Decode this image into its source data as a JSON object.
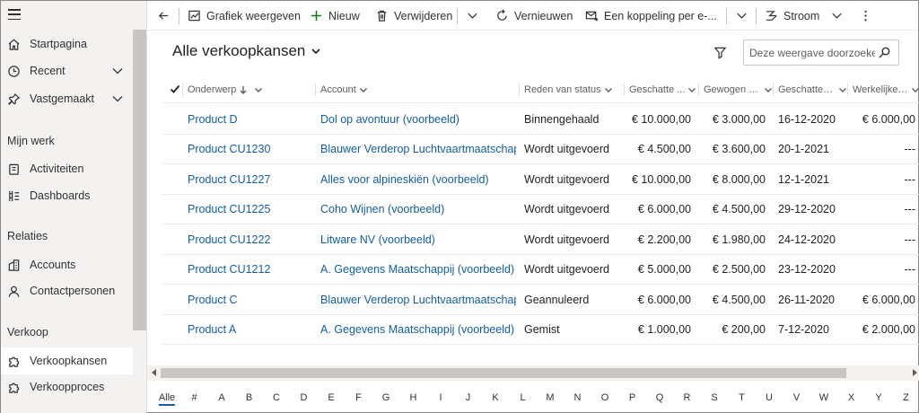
{
  "sidebar": {
    "items": [
      {
        "label": "Startpagina",
        "icon": "home-icon"
      },
      {
        "label": "Recent",
        "icon": "clock-icon"
      },
      {
        "label": "Vastgemaakt",
        "icon": "pin-icon"
      }
    ],
    "groups": [
      {
        "title": "Mijn werk",
        "items": [
          {
            "label": "Activiteiten",
            "icon": "activities-icon"
          },
          {
            "label": "Dashboards",
            "icon": "dashboard-icon"
          }
        ]
      },
      {
        "title": "Relaties",
        "items": [
          {
            "label": "Accounts",
            "icon": "account-icon"
          },
          {
            "label": "Contactpersonen",
            "icon": "person-icon"
          }
        ]
      },
      {
        "title": "Verkoop",
        "items": [
          {
            "label": "Verkoopkansen",
            "icon": "puzzle-icon",
            "active": true
          },
          {
            "label": "Verkoopproces",
            "icon": "puzzle-icon"
          }
        ]
      }
    ]
  },
  "command_bar": {
    "chart": "Grafiek weergeven",
    "new": "Nieuw",
    "delete": "Verwijderen",
    "refresh": "Vernieuwen",
    "email_link": "Een koppeling per e-...",
    "flow": "Stroom"
  },
  "view": {
    "title": "Alle verkoopkansen",
    "search_placeholder": "Deze weergave doorzoeke"
  },
  "grid": {
    "columns": [
      "Onderwerp",
      "Account",
      "Reden van status",
      "Geschatte ...",
      "Gewogen o...",
      "Geschatte s...",
      "Werkelijke ..."
    ],
    "rows": [
      {
        "subject": "Product D",
        "account": "Dol op avontuur (voorbeeld)",
        "status": "Binnengehaald",
        "est_revenue": "€ 10.000,00",
        "weighted": "€ 3.000,00",
        "est_close": "16-12-2020",
        "actual": "€ 6.000,00"
      },
      {
        "subject": "Product CU1230",
        "account": "Blauwer Verderop Luchtvaartmaatschappij",
        "status": "Wordt uitgevoerd",
        "est_revenue": "€ 4.500,00",
        "weighted": "€ 3.600,00",
        "est_close": "20-1-2021",
        "actual": "---"
      },
      {
        "subject": "Product CU1227",
        "account": "Alles voor alpineskiën (voorbeeld)",
        "status": "Wordt uitgevoerd",
        "est_revenue": "€ 10.000,00",
        "weighted": "€ 8.000,00",
        "est_close": "12-1-2021",
        "actual": "---"
      },
      {
        "subject": "Product CU1225",
        "account": "Coho Wijnen (voorbeeld)",
        "status": "Wordt uitgevoerd",
        "est_revenue": "€ 6.000,00",
        "weighted": "€ 4.500,00",
        "est_close": "29-12-2020",
        "actual": "---"
      },
      {
        "subject": "Product CU1222",
        "account": "Litware NV (voorbeeld)",
        "status": "Wordt uitgevoerd",
        "est_revenue": "€ 2.200,00",
        "weighted": "€ 1.980,00",
        "est_close": "24-12-2020",
        "actual": "---"
      },
      {
        "subject": "Product CU1212",
        "account": "A. Gegevens Maatschappij (voorbeeld)",
        "status": "Wordt uitgevoerd",
        "est_revenue": "€ 5.000,00",
        "weighted": "€ 2.500,00",
        "est_close": "23-12-2020",
        "actual": "---"
      },
      {
        "subject": "Product C",
        "account": "Blauwer Verderop Luchtvaartmaatschappij",
        "status": "Geannuleerd",
        "est_revenue": "€ 6.000,00",
        "weighted": "€ 4.500,00",
        "est_close": "26-11-2020",
        "actual": "€ 6.000,00"
      },
      {
        "subject": "Product A",
        "account": "A. Gegevens Maatschappij (voorbeeld)",
        "status": "Gemist",
        "est_revenue": "€ 1.000,00",
        "weighted": "€ 200,00",
        "est_close": "7-12-2020",
        "actual": "€ 2.000,00"
      }
    ]
  },
  "alpha_bar": {
    "selected": "Alle",
    "letters": [
      "Alle",
      "#",
      "A",
      "B",
      "C",
      "D",
      "E",
      "F",
      "G",
      "H",
      "I",
      "J",
      "K",
      "L",
      "M",
      "N",
      "O",
      "P",
      "Q",
      "R",
      "S",
      "T",
      "U",
      "V",
      "W",
      "X",
      "Y",
      "Z"
    ]
  },
  "colors": {
    "link": "#115ea3",
    "sidebar_bg": "#f3f2f1",
    "text": "#323130"
  }
}
